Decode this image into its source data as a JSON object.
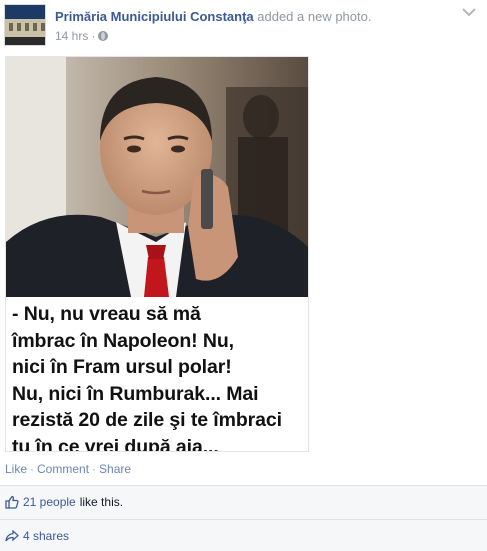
{
  "post": {
    "page_name": "Primăria Municipiului Constanţa",
    "action": "added a new photo.",
    "timestamp": "14 hrs",
    "meta_separator": "·",
    "audience_icon": "globe-icon",
    "options_icon": "chevron-down-icon"
  },
  "photo": {
    "caption_lines": [
      "- Nu, nu vreau să mă",
      "îmbrac în Napoleon! Nu,",
      "nici în Fram ursul polar!",
      "Nu, nici în Rumburak... Mai",
      "rezistă 20 de zile şi te îmbraci",
      "tu în ce vrei după aia..."
    ]
  },
  "actions": {
    "like": "Like",
    "comment": "Comment",
    "share": "Share",
    "separator": "·"
  },
  "ufi": {
    "likes_link": "21 people",
    "likes_suffix": "like this.",
    "shares_link": "4 shares",
    "like_icon": "thumbs-up-icon",
    "share_icon": "share-arrow-icon"
  },
  "colors": {
    "link_blue": "#3b5998",
    "muted_grey": "#9197a3",
    "action_blue": "#6d84b4",
    "footer_bg": "#f6f7f9"
  }
}
